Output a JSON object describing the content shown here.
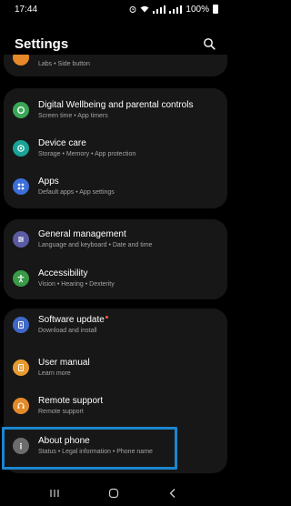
{
  "status_bar": {
    "time": "17:44",
    "battery": "100%"
  },
  "header": {
    "title": "Settings"
  },
  "top_partial": {
    "subtitle": "Labs  •  Side button"
  },
  "groups": [
    {
      "items": [
        {
          "title": "Digital Wellbeing and parental controls",
          "subtitle": "Screen time  •  App timers",
          "icon": "wellbeing-icon",
          "color": "#3aa657"
        },
        {
          "title": "Device care",
          "subtitle": "Storage  •  Memory  •  App protection",
          "icon": "device-care-icon",
          "color": "#1aa397"
        },
        {
          "title": "Apps",
          "subtitle": "Default apps  •  App settings",
          "icon": "apps-icon",
          "color": "#3e6ed9"
        }
      ]
    },
    {
      "items": [
        {
          "title": "General management",
          "subtitle": "Language and keyboard  •  Date and time",
          "icon": "general-management-icon",
          "color": "#5b5ba3"
        },
        {
          "title": "Accessibility",
          "subtitle": "Vision  •  Hearing  •  Dexterity",
          "icon": "accessibility-icon",
          "color": "#3a9a47"
        }
      ]
    },
    {
      "items": [
        {
          "title": "Software update",
          "subtitle": "Download and install",
          "icon": "software-update-icon",
          "color": "#3f68c9",
          "badge": true
        },
        {
          "title": "User manual",
          "subtitle": "Learn more",
          "icon": "user-manual-icon",
          "color": "#e79b2f"
        },
        {
          "title": "Remote support",
          "subtitle": "Remote support",
          "icon": "remote-support-icon",
          "color": "#e48a2b"
        },
        {
          "title": "About phone",
          "subtitle": "Status  •  Legal information  •  Phone name",
          "icon": "about-phone-icon",
          "color": "#6c6c6c"
        }
      ]
    }
  ],
  "nav": {
    "recents": "recents-icon",
    "home": "home-icon",
    "back": "back-icon"
  }
}
